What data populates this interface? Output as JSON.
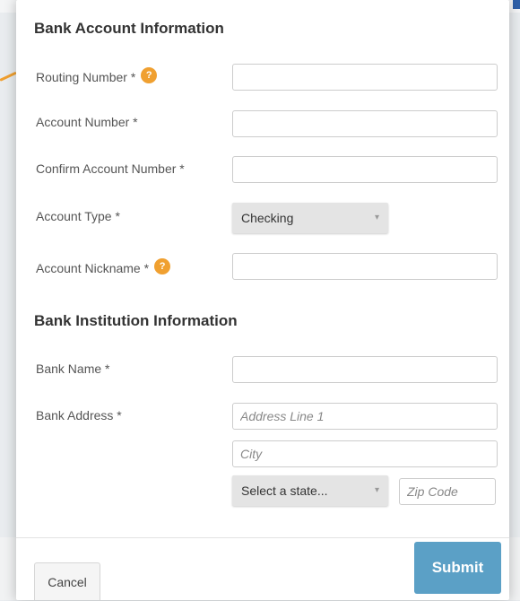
{
  "sections": {
    "bank_account_title": "Bank Account Information",
    "bank_institution_title": "Bank Institution Information"
  },
  "fields": {
    "routing_number": {
      "label": "Routing Number *",
      "value": ""
    },
    "account_number": {
      "label": "Account Number *",
      "value": ""
    },
    "confirm_account_number": {
      "label": "Confirm Account Number *",
      "value": ""
    },
    "account_type": {
      "label": "Account Type *",
      "selected": "Checking"
    },
    "account_nickname": {
      "label": "Account Nickname *",
      "value": ""
    },
    "bank_name": {
      "label": "Bank Name *",
      "value": ""
    },
    "bank_address": {
      "label": "Bank Address *",
      "address_line1_placeholder": "Address Line 1",
      "city_placeholder": "City",
      "state_selected": "Select a state...",
      "zip_placeholder": "Zip Code"
    }
  },
  "icons": {
    "help": "help-icon",
    "help_glyph": "?",
    "chevron": "chevron-down-icon",
    "chevron_glyph": "▾"
  },
  "buttons": {
    "cancel_label": "Cancel",
    "submit_label": "Submit"
  },
  "colors": {
    "accent_orange": "#f0a030",
    "submit_blue": "#5ba0c6",
    "corner_blue": "#2d5fa8"
  }
}
